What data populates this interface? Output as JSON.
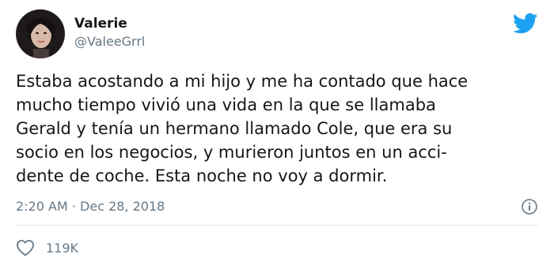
{
  "tweet": {
    "user": {
      "display_name": "Valerie",
      "handle": "@ValeeGrrl"
    },
    "text_lines": [
      "Estaba acostando a mi hijo y me ha contado que hace",
      "mucho tiempo vivió una vida en la que se llamaba",
      "Gerald y tenía un hermano llamado Cole, que era su",
      "socio en los negocios, y murieron juntos en un acci-",
      "dente de coche. Esta noche no voy a dormir."
    ],
    "timestamp": "2:20 AM · Dec 28, 2018",
    "likes": "119K"
  },
  "icons": {
    "logo": "twitter-bird-icon",
    "info": "info-icon",
    "like": "heart-icon"
  },
  "colors": {
    "brand": "#1da1f2",
    "text": "#14171a",
    "secondary": "#657786",
    "divider": "#e1e8ed"
  }
}
